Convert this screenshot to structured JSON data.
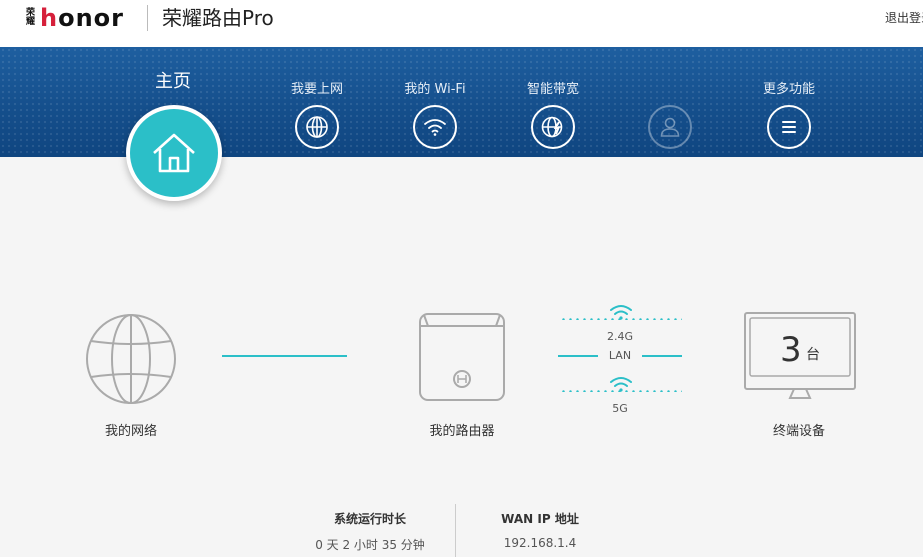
{
  "header": {
    "logo_cn_top": "荣",
    "logo_cn_bottom": "耀",
    "logo_en_first": "h",
    "logo_en_rest": "onor",
    "product_title": "荣耀路由Pro",
    "logout_label": "退出登录"
  },
  "nav": {
    "home_label": "主页",
    "items": [
      {
        "label": "我要上网",
        "icon": "globe-icon"
      },
      {
        "label": "我的 Wi-Fi",
        "icon": "wifi-icon"
      },
      {
        "label": "智能带宽",
        "icon": "bandwidth-icon"
      },
      {
        "label": "",
        "icon": "user-icon",
        "disabled": true
      },
      {
        "label": "更多功能",
        "icon": "menu-icon"
      }
    ]
  },
  "topology": {
    "network_label": "我的网络",
    "router_label": "我的路由器",
    "band_24": "2.4G",
    "band_lan": "LAN",
    "band_5": "5G",
    "devices_label": "终端设备",
    "device_count": "3",
    "device_unit": "台"
  },
  "stats": {
    "uptime_title": "系统运行时长",
    "uptime_value": "0 天 2 小时 35 分钟",
    "wan_title": "WAN IP 地址",
    "wan_value": "192.168.1.4"
  },
  "colors": {
    "accent": "#2bbfc8",
    "nav_bg": "#154f8c",
    "brand_red": "#d6203b"
  }
}
